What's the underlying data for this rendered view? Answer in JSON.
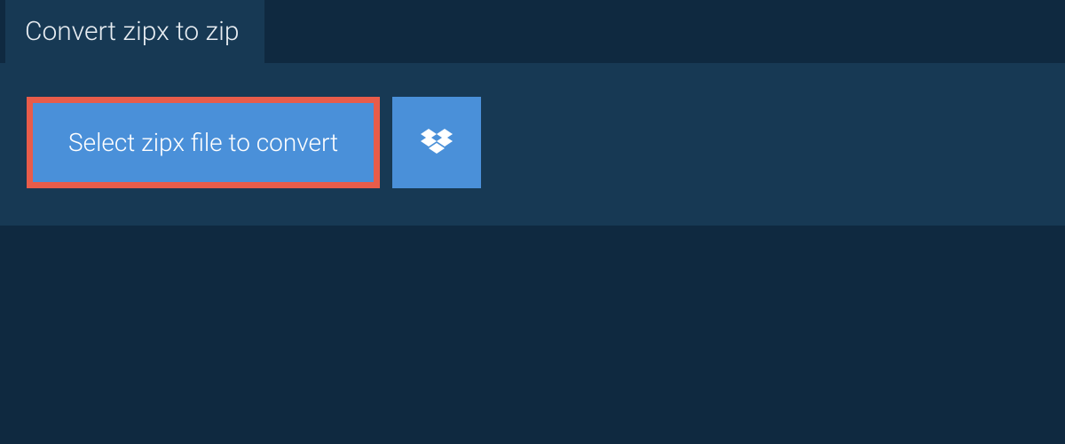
{
  "tab": {
    "title": "Convert zipx to zip"
  },
  "buttons": {
    "select_label": "Select zipx file to convert"
  },
  "colors": {
    "background": "#0f2940",
    "panel": "#173954",
    "button": "#4a90d9",
    "highlight_border": "#e85c4a",
    "text_light": "#e8edf2",
    "text_white": "#ffffff"
  }
}
